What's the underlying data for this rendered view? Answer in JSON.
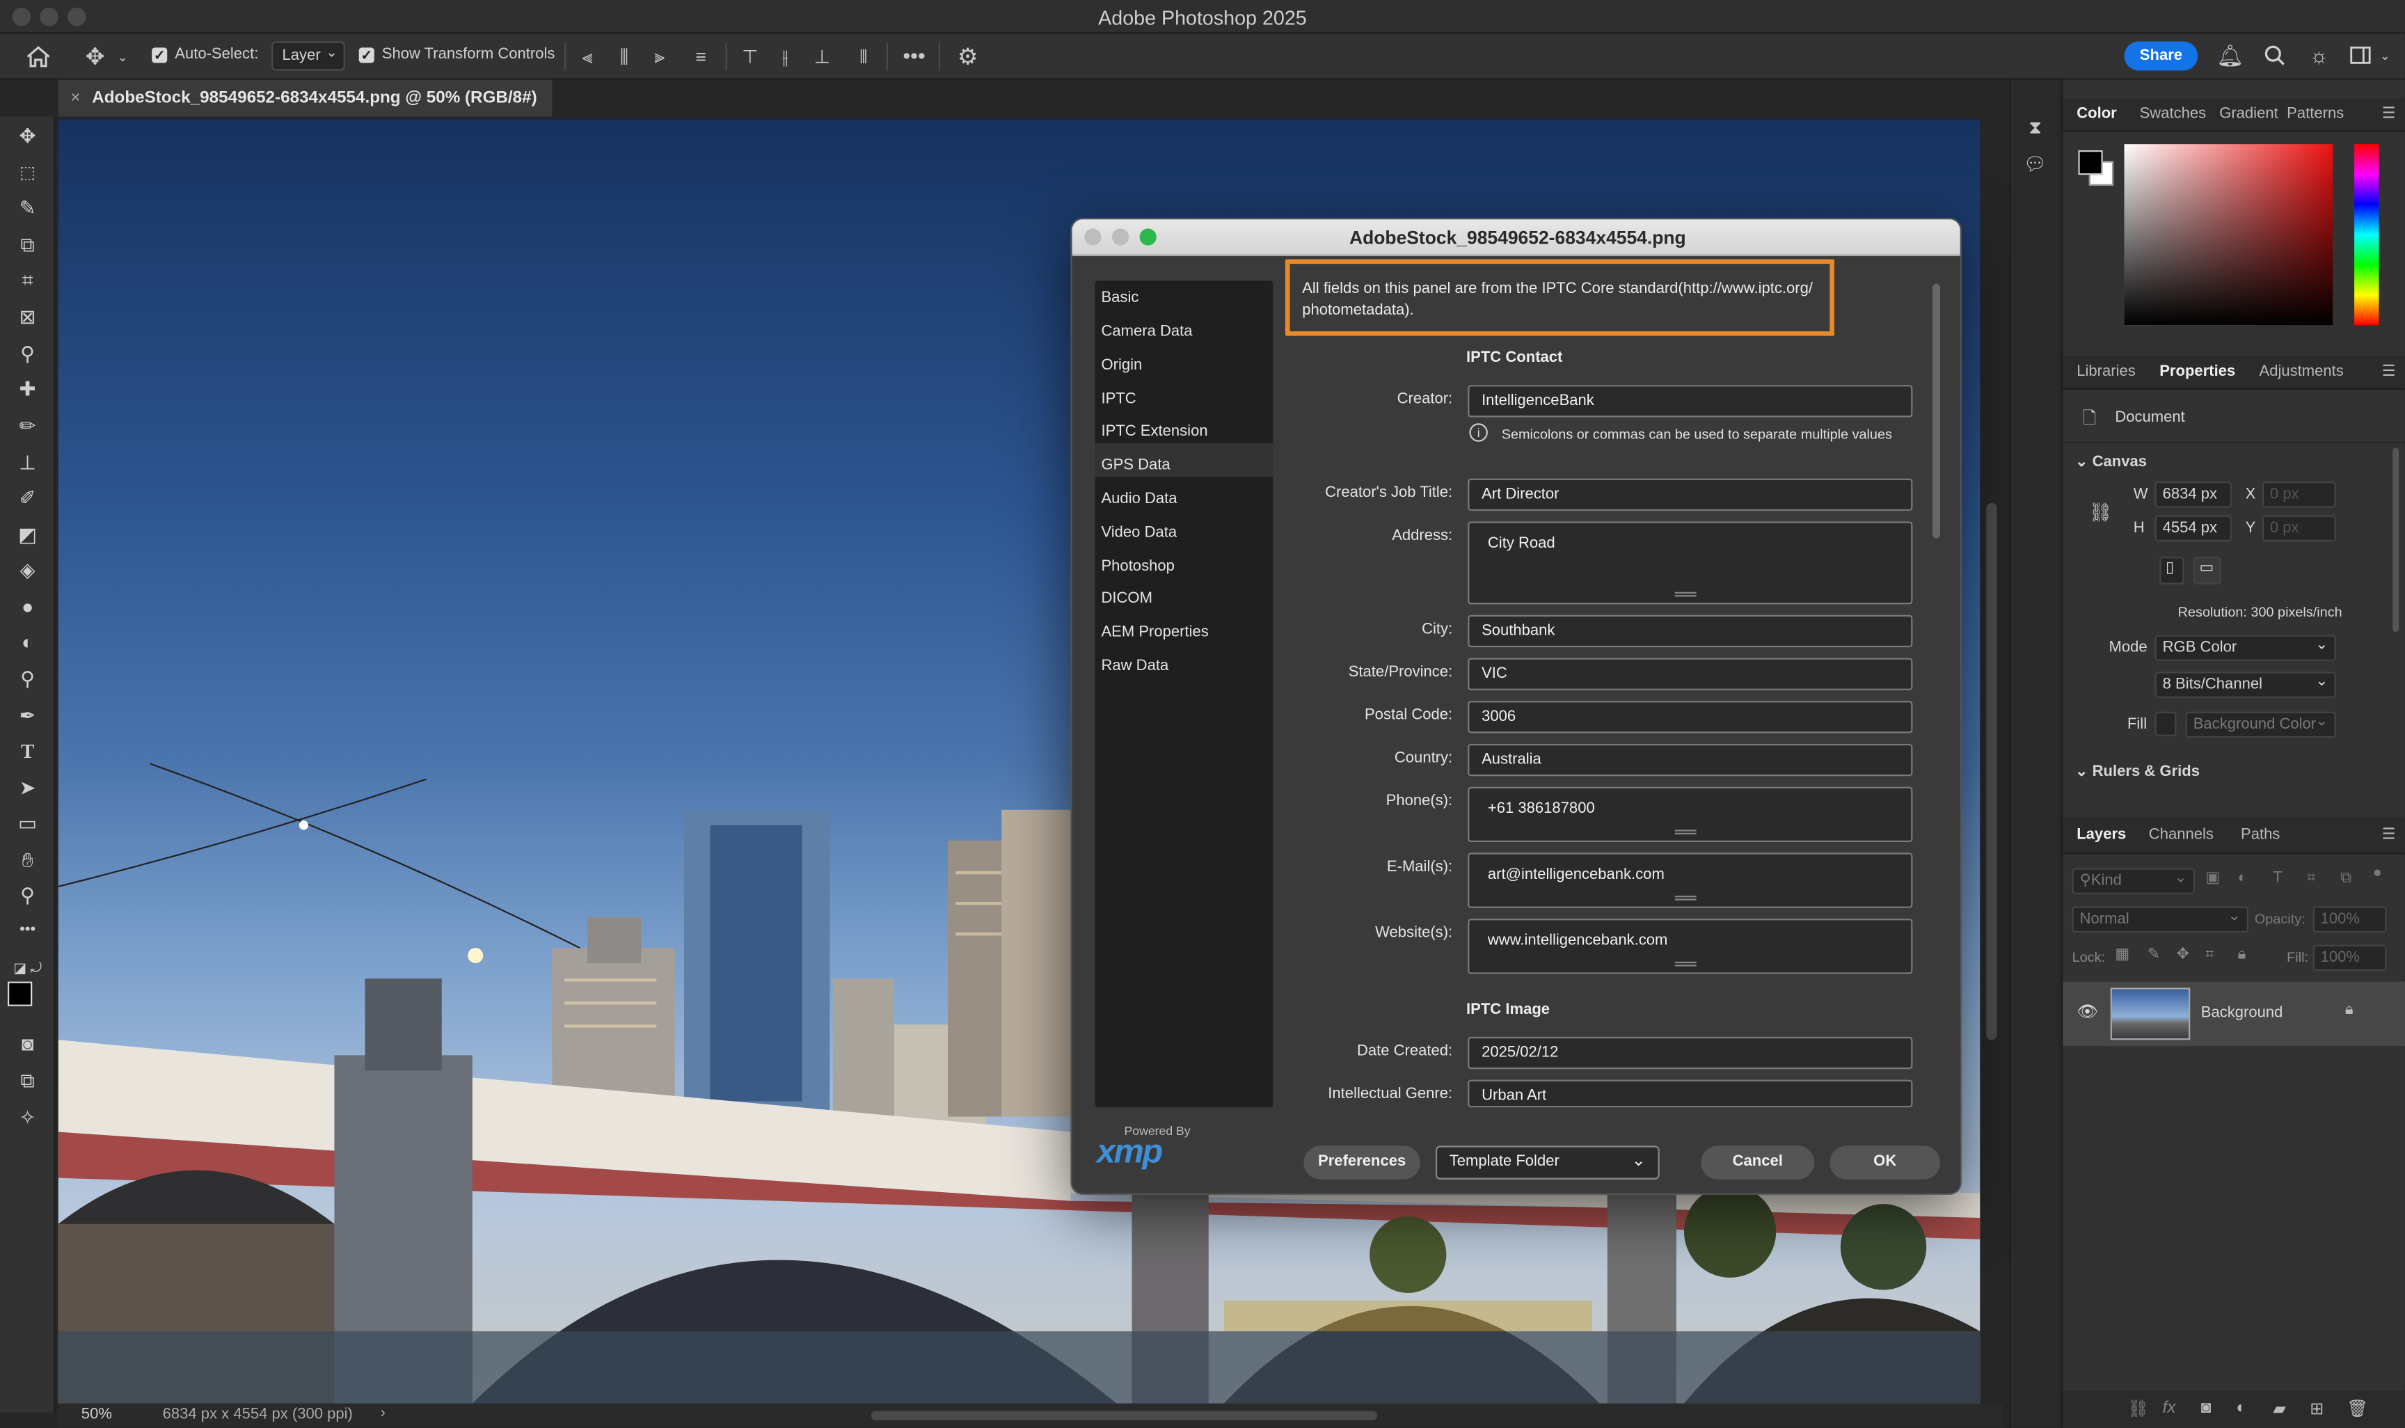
{
  "app": {
    "title": "Adobe Photoshop 2025"
  },
  "options_bar": {
    "auto_select_label": "Auto-Select:",
    "auto_select_value": "Layer",
    "show_transform_label": "Show Transform Controls",
    "share_label": "Share"
  },
  "document": {
    "tab_title": "AdobeStock_98549652-6834x4554.png @ 50% (RGB/8#)",
    "zoom": "50%",
    "dimensions": "6834 px x 4554 px (300 ppi)"
  },
  "color_panel": {
    "tabs": [
      "Color",
      "Swatches",
      "Gradient",
      "Patterns"
    ]
  },
  "properties_panel": {
    "tabs": [
      "Libraries",
      "Properties",
      "Adjustments"
    ],
    "document_label": "Document",
    "canvas_label": "Canvas",
    "w_label": "W",
    "w_value": "6834 px",
    "h_label": "H",
    "h_value": "4554 px",
    "x_label": "X",
    "x_placeholder": "0 px",
    "y_label": "Y",
    "y_placeholder": "0 px",
    "resolution": "Resolution: 300 pixels/inch",
    "mode_label": "Mode",
    "mode_value": "RGB Color",
    "bits_value": "8 Bits/Channel",
    "fill_label": "Fill",
    "fill_value": "Background Color",
    "rulers_label": "Rulers & Grids"
  },
  "layers_panel": {
    "tabs": [
      "Layers",
      "Channels",
      "Paths"
    ],
    "kind_label": "Kind",
    "blend_mode": "Normal",
    "opacity_label": "Opacity:",
    "opacity_value": "100%",
    "lock_label": "Lock:",
    "fill_label": "Fill:",
    "fill_value": "100%",
    "layer_name": "Background"
  },
  "dialog": {
    "title": "AdobeStock_98549652-6834x4554.png",
    "categories": [
      "Basic",
      "Camera Data",
      "Origin",
      "IPTC",
      "IPTC Extension",
      "GPS Data",
      "Audio Data",
      "Video Data",
      "Photoshop",
      "DICOM",
      "AEM Properties",
      "Raw Data"
    ],
    "selected_category": "IPTC",
    "info_text": "All fields on this panel are from the IPTC Core standard(http://www.iptc.org/ photometadata).",
    "section_contact": "IPTC Contact",
    "section_image": "IPTC Image",
    "hint": "Semicolons or commas can be used to separate multiple values",
    "fields": {
      "creator": {
        "label": "Creator:",
        "value": "IntelligenceBank"
      },
      "job_title": {
        "label": "Creator's Job Title:",
        "value": "Art Director"
      },
      "address": {
        "label": "Address:",
        "value": "City Road"
      },
      "city": {
        "label": "City:",
        "value": "Southbank"
      },
      "state": {
        "label": "State/Province:",
        "value": "VIC"
      },
      "postal": {
        "label": "Postal Code:",
        "value": "3006"
      },
      "country": {
        "label": "Country:",
        "value": "Australia"
      },
      "phone": {
        "label": "Phone(s):",
        "value": "+61 386187800"
      },
      "email": {
        "label": "E-Mail(s):",
        "value": "art@intelligencebank.com"
      },
      "website": {
        "label": "Website(s):",
        "value": "www.intelligencebank.com"
      },
      "date_created": {
        "label": "Date Created:",
        "value": "2025/02/12"
      },
      "genre": {
        "label": "Intellectual Genre:",
        "value": "Urban Art"
      }
    },
    "powered_by": "Powered By",
    "xmp_logo": "xmp",
    "preferences_label": "Preferences",
    "template_folder_label": "Template Folder",
    "cancel_label": "Cancel",
    "ok_label": "OK"
  }
}
